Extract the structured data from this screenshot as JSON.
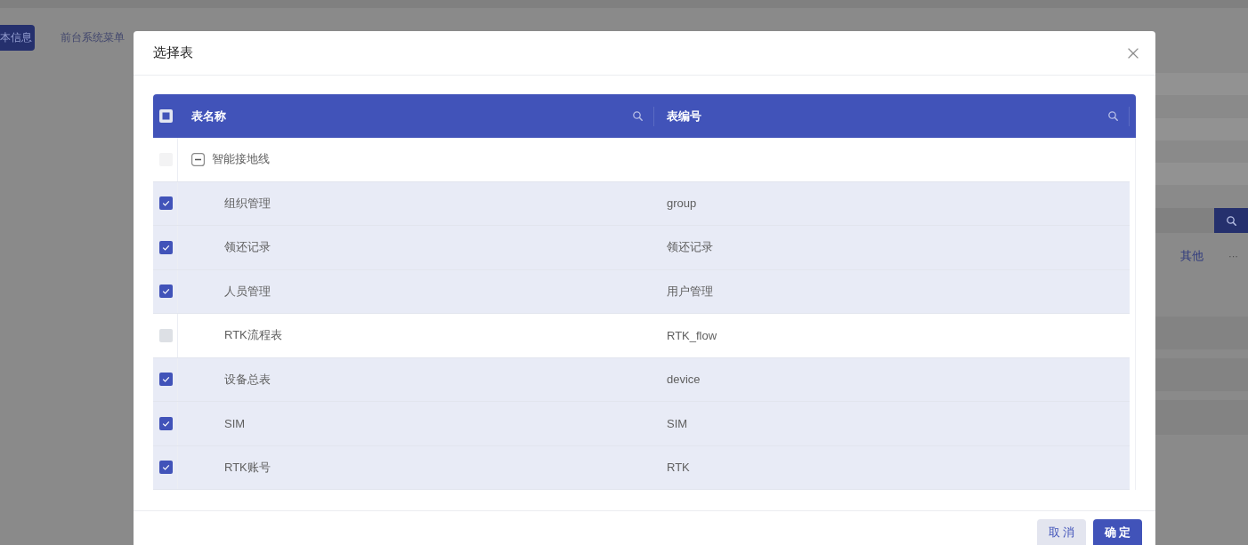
{
  "background_page": {
    "tabs": [
      {
        "label": "本信息",
        "selected": true
      },
      {
        "label": "前台系统菜单",
        "selected": false
      }
    ],
    "side_menu": [
      {
        "label": "其他",
        "kind": "link"
      },
      {
        "label": "···",
        "kind": "more"
      }
    ]
  },
  "dialog": {
    "title": "选择表",
    "table": {
      "select_all": {
        "checked": false,
        "indeterminate": true
      },
      "columns": [
        {
          "title": "表名称"
        },
        {
          "title": "表编号"
        }
      ],
      "rows": [
        {
          "name": "智能接地线",
          "checked": false,
          "disabled": true,
          "expanded": true,
          "children": [
            {
              "name": "组织管理",
              "code": "group",
              "checked": true
            },
            {
              "name": "领还记录",
              "code": "领还记录",
              "checked": true
            },
            {
              "name": "人员管理",
              "code": "用户管理",
              "checked": true
            },
            {
              "name": "RTK流程表",
              "code": "RTK_flow",
              "checked": false
            },
            {
              "name": "设备总表",
              "code": "device",
              "checked": true
            },
            {
              "name": "SIM",
              "code": "SIM",
              "checked": true
            },
            {
              "name": "RTK账号",
              "code": "RTK",
              "checked": true
            }
          ]
        }
      ]
    },
    "buttons": [
      {
        "label": "取 消",
        "kind": "secondary"
      },
      {
        "label": "确 定",
        "kind": "primary"
      }
    ]
  }
}
